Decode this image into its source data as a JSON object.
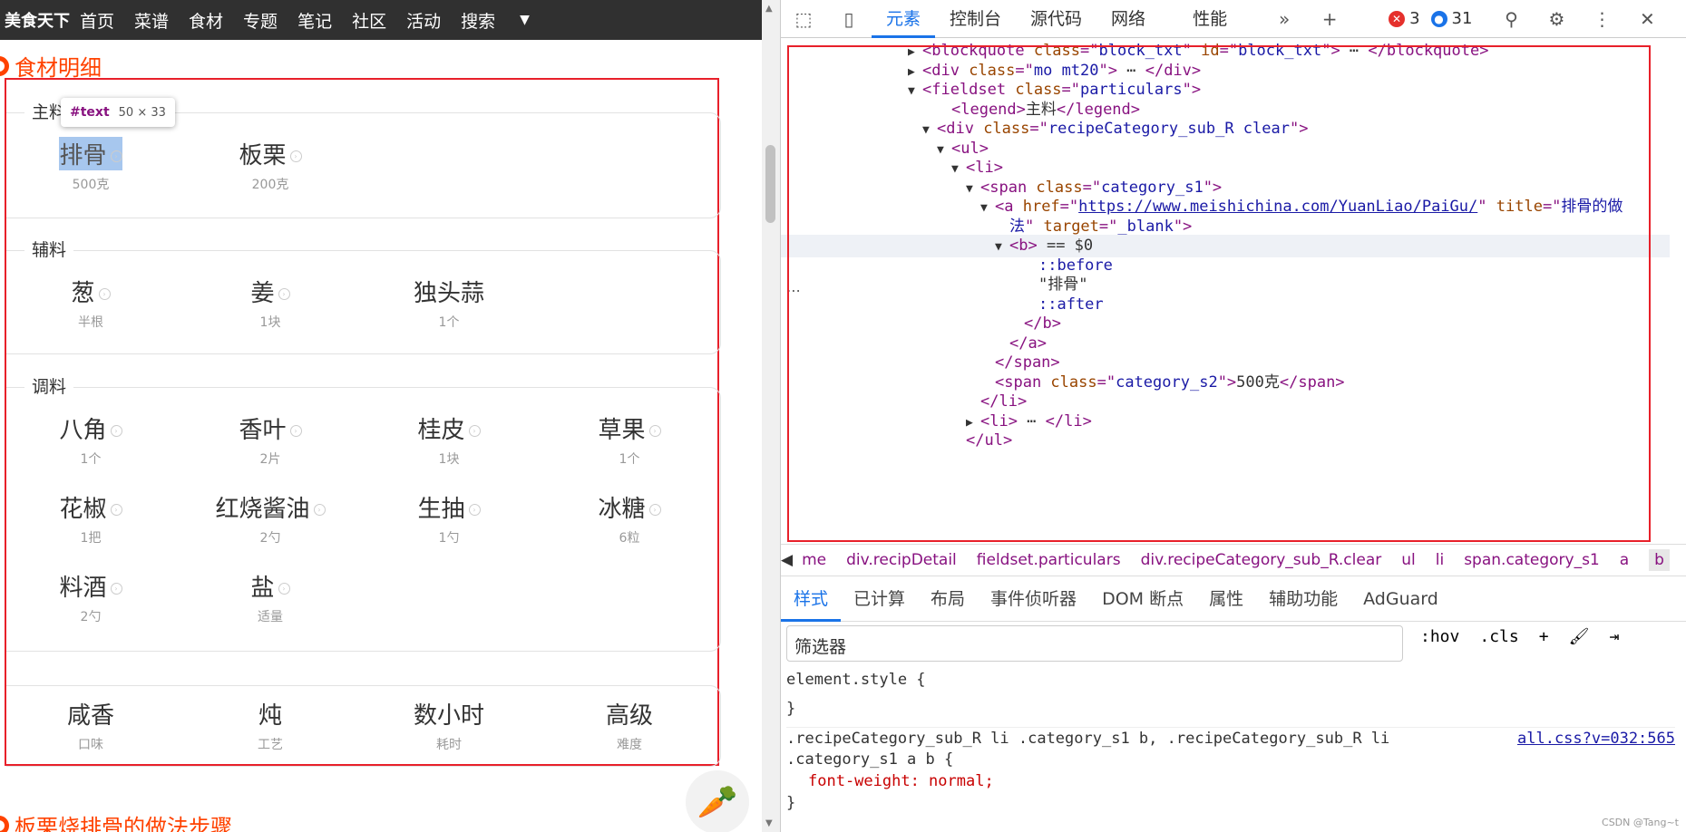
{
  "site": {
    "logo": "美食天下",
    "nav": [
      "首页",
      "菜谱",
      "食材",
      "专题",
      "笔记",
      "社区",
      "活动",
      "搜索"
    ]
  },
  "section1": "食材明细",
  "section2": "板栗烧排骨的做法步骤",
  "tooltip": {
    "name": "#text",
    "size": "50 × 33"
  },
  "groups": {
    "main": {
      "title": "主料",
      "items": [
        {
          "name": "排骨",
          "amount": "500克"
        },
        {
          "name": "板栗",
          "amount": "200克"
        }
      ]
    },
    "aux": {
      "title": "辅料",
      "items": [
        {
          "name": "葱",
          "amount": "半根"
        },
        {
          "name": "姜",
          "amount": "1块"
        },
        {
          "name": "独头蒜",
          "amount": "1个"
        }
      ]
    },
    "season": {
      "title": "调料",
      "items": [
        {
          "name": "八角",
          "amount": "1个"
        },
        {
          "name": "香叶",
          "amount": "2片"
        },
        {
          "name": "桂皮",
          "amount": "1块"
        },
        {
          "name": "草果",
          "amount": "1个"
        },
        {
          "name": "花椒",
          "amount": "1把"
        },
        {
          "name": "红烧酱油",
          "amount": "2勺"
        },
        {
          "name": "生抽",
          "amount": "1勺"
        },
        {
          "name": "冰糖",
          "amount": "6粒"
        },
        {
          "name": "料酒",
          "amount": "2勺"
        },
        {
          "name": "盐",
          "amount": "适量"
        }
      ]
    },
    "props": {
      "items": [
        {
          "name": "咸香",
          "amount": "口味"
        },
        {
          "name": "炖",
          "amount": "工艺"
        },
        {
          "name": "数小时",
          "amount": "耗时"
        },
        {
          "name": "高级",
          "amount": "难度"
        }
      ]
    }
  },
  "devtools": {
    "tabs": [
      "元素",
      "控制台",
      "源代码",
      "网络",
      "性能"
    ],
    "errors": "3",
    "messages": "31",
    "code": [
      {
        "ind": 140,
        "tri": "▶",
        "html": [
          [
            "tag",
            "<blockquote "
          ],
          [
            "attr",
            "class"
          ],
          [
            "tag",
            "=\""
          ],
          [
            "val",
            "block_txt"
          ],
          [
            "tag",
            "\" "
          ],
          [
            "attr",
            "id"
          ],
          [
            "tag",
            "=\""
          ],
          [
            "val",
            "block_txt"
          ],
          [
            "tag",
            "\">"
          ],
          [
            "txt",
            " ⋯ "
          ],
          [
            "tag",
            "</blockquote>"
          ]
        ]
      },
      {
        "ind": 140,
        "tri": "▶",
        "html": [
          [
            "tag",
            "<div "
          ],
          [
            "attr",
            "class"
          ],
          [
            "tag",
            "=\""
          ],
          [
            "val",
            "mo mt20"
          ],
          [
            "tag",
            "\">"
          ],
          [
            "txt",
            " ⋯ "
          ],
          [
            "tag",
            "</div>"
          ]
        ]
      },
      {
        "ind": 140,
        "tri": "▼",
        "html": [
          [
            "tag",
            "<fieldset "
          ],
          [
            "attr",
            "class"
          ],
          [
            "tag",
            "=\""
          ],
          [
            "val",
            "particulars"
          ],
          [
            "tag",
            "\">"
          ]
        ]
      },
      {
        "ind": 172,
        "tri": "",
        "html": [
          [
            "tag",
            "<legend>"
          ],
          [
            "txt",
            "主料"
          ],
          [
            "tag",
            "</legend>"
          ]
        ]
      },
      {
        "ind": 156,
        "tri": "▼",
        "html": [
          [
            "tag",
            "<div "
          ],
          [
            "attr",
            "class"
          ],
          [
            "tag",
            "=\""
          ],
          [
            "val",
            "recipeCategory_sub_R clear"
          ],
          [
            "tag",
            "\">"
          ]
        ]
      },
      {
        "ind": 172,
        "tri": "▼",
        "html": [
          [
            "tag",
            "<ul>"
          ]
        ]
      },
      {
        "ind": 188,
        "tri": "▼",
        "html": [
          [
            "tag",
            "<li>"
          ]
        ]
      },
      {
        "ind": 204,
        "tri": "▼",
        "html": [
          [
            "tag",
            "<span "
          ],
          [
            "attr",
            "class"
          ],
          [
            "tag",
            "=\""
          ],
          [
            "val",
            "category_s1"
          ],
          [
            "tag",
            "\">"
          ]
        ]
      },
      {
        "ind": 220,
        "tri": "▼",
        "html": [
          [
            "tag",
            "<a "
          ],
          [
            "attr",
            "href"
          ],
          [
            "tag",
            "=\""
          ],
          [
            "link",
            "https://www.meishichina.com/YuanLiao/PaiGu/"
          ],
          [
            "tag",
            "\" "
          ],
          [
            "attr",
            "title"
          ],
          [
            "tag",
            "=\""
          ],
          [
            "val",
            "排骨的做"
          ]
        ]
      },
      {
        "ind": 236,
        "tri": "",
        "html": [
          [
            "val",
            "法"
          ],
          [
            "tag",
            "\" "
          ],
          [
            "attr",
            "target"
          ],
          [
            "tag",
            "=\""
          ],
          [
            "val",
            "_blank"
          ],
          [
            "tag",
            "\">"
          ]
        ]
      },
      {
        "ind": 236,
        "tri": "▼",
        "sel": true,
        "html": [
          [
            "tag",
            "<b>"
          ],
          [
            "txt",
            " == $0"
          ]
        ]
      },
      {
        "ind": 268,
        "tri": "",
        "html": [
          [
            "pseudo",
            "::before"
          ]
        ]
      },
      {
        "ind": 268,
        "tri": "",
        "html": [
          [
            "txt",
            "\"排骨\""
          ]
        ]
      },
      {
        "ind": 268,
        "tri": "",
        "html": [
          [
            "pseudo",
            "::after"
          ]
        ]
      },
      {
        "ind": 252,
        "tri": "",
        "html": [
          [
            "tag",
            "</b>"
          ]
        ]
      },
      {
        "ind": 236,
        "tri": "",
        "html": [
          [
            "tag",
            "</a>"
          ]
        ]
      },
      {
        "ind": 220,
        "tri": "",
        "html": [
          [
            "tag",
            "</span>"
          ]
        ]
      },
      {
        "ind": 220,
        "tri": "",
        "html": [
          [
            "tag",
            "<span "
          ],
          [
            "attr",
            "class"
          ],
          [
            "tag",
            "=\""
          ],
          [
            "val",
            "category_s2"
          ],
          [
            "tag",
            "\">"
          ],
          [
            "txt",
            "500克"
          ],
          [
            "tag",
            "</span>"
          ]
        ]
      },
      {
        "ind": 204,
        "tri": "",
        "html": [
          [
            "tag",
            "</li>"
          ]
        ]
      },
      {
        "ind": 204,
        "tri": "▶",
        "html": [
          [
            "tag",
            "<li>"
          ],
          [
            "txt",
            " ⋯ "
          ],
          [
            "tag",
            "</li>"
          ]
        ]
      },
      {
        "ind": 188,
        "tri": "",
        "html": [
          [
            "tag",
            "</ul>"
          ]
        ]
      }
    ],
    "breadcrumbs": [
      "me",
      "div.recipDetail",
      "fieldset.particulars",
      "div.recipeCategory_sub_R.clear",
      "ul",
      "li",
      "span.category_s1",
      "a",
      "b"
    ],
    "style_tabs": [
      "样式",
      "已计算",
      "布局",
      "事件侦听器",
      "DOM 断点",
      "属性",
      "辅助功能",
      "AdGuard"
    ],
    "filter_placeholder": "筛选器",
    "tools": [
      ":hov",
      ".cls",
      "+"
    ],
    "css_rules": [
      "element.style {",
      "}",
      ".recipeCategory_sub_R li .category_s1 b, .recipeCategory_sub_R li",
      ".category_s1 a b {",
      "font-weight: normal;",
      "}"
    ],
    "css_source": "all.css?v=032:565",
    "watermark": "CSDN @Tang~t"
  }
}
